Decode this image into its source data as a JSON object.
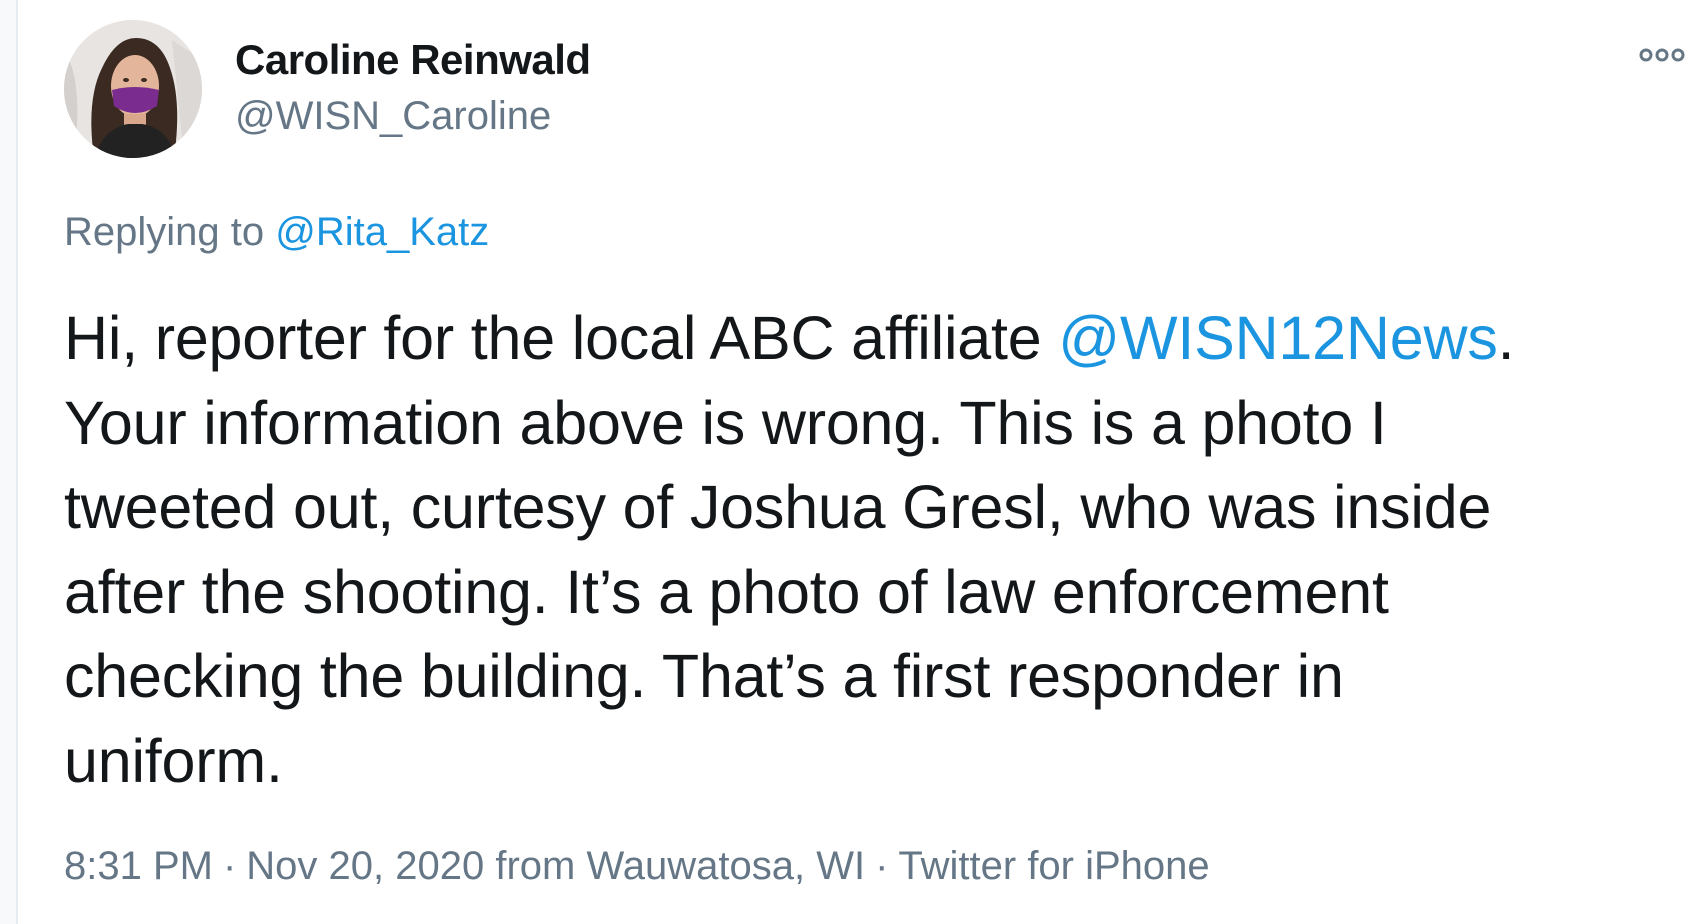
{
  "author": {
    "display_name": "Caroline Reinwald",
    "handle": "@WISN_Caroline"
  },
  "header": {
    "more_icon": "more-options-icon"
  },
  "reply": {
    "prefix": "Replying to ",
    "mention": "@Rita_Katz"
  },
  "tweet": {
    "line1_before": "Hi, reporter for the local ABC affiliate ",
    "line1_mention": "@WISN12News",
    "line1_after": ".",
    "line2": "Your information above is wrong. This is a photo I",
    "line3": "tweeted out, curtesy of Joshua Gresl, who was inside",
    "line4": "after the shooting. It’s a photo of law enforcement",
    "line5": "checking the building. That’s a first responder in",
    "line6": "uniform."
  },
  "meta": {
    "time": "8:31 PM",
    "separator": "·",
    "date_location": "Nov 20, 2020 from Wauwatosa, WI",
    "client": "Twitter for iPhone"
  },
  "colors": {
    "text": "#14171a",
    "secondary": "#657786",
    "link": "#1b95e0",
    "mask": "#7b2d8f"
  }
}
